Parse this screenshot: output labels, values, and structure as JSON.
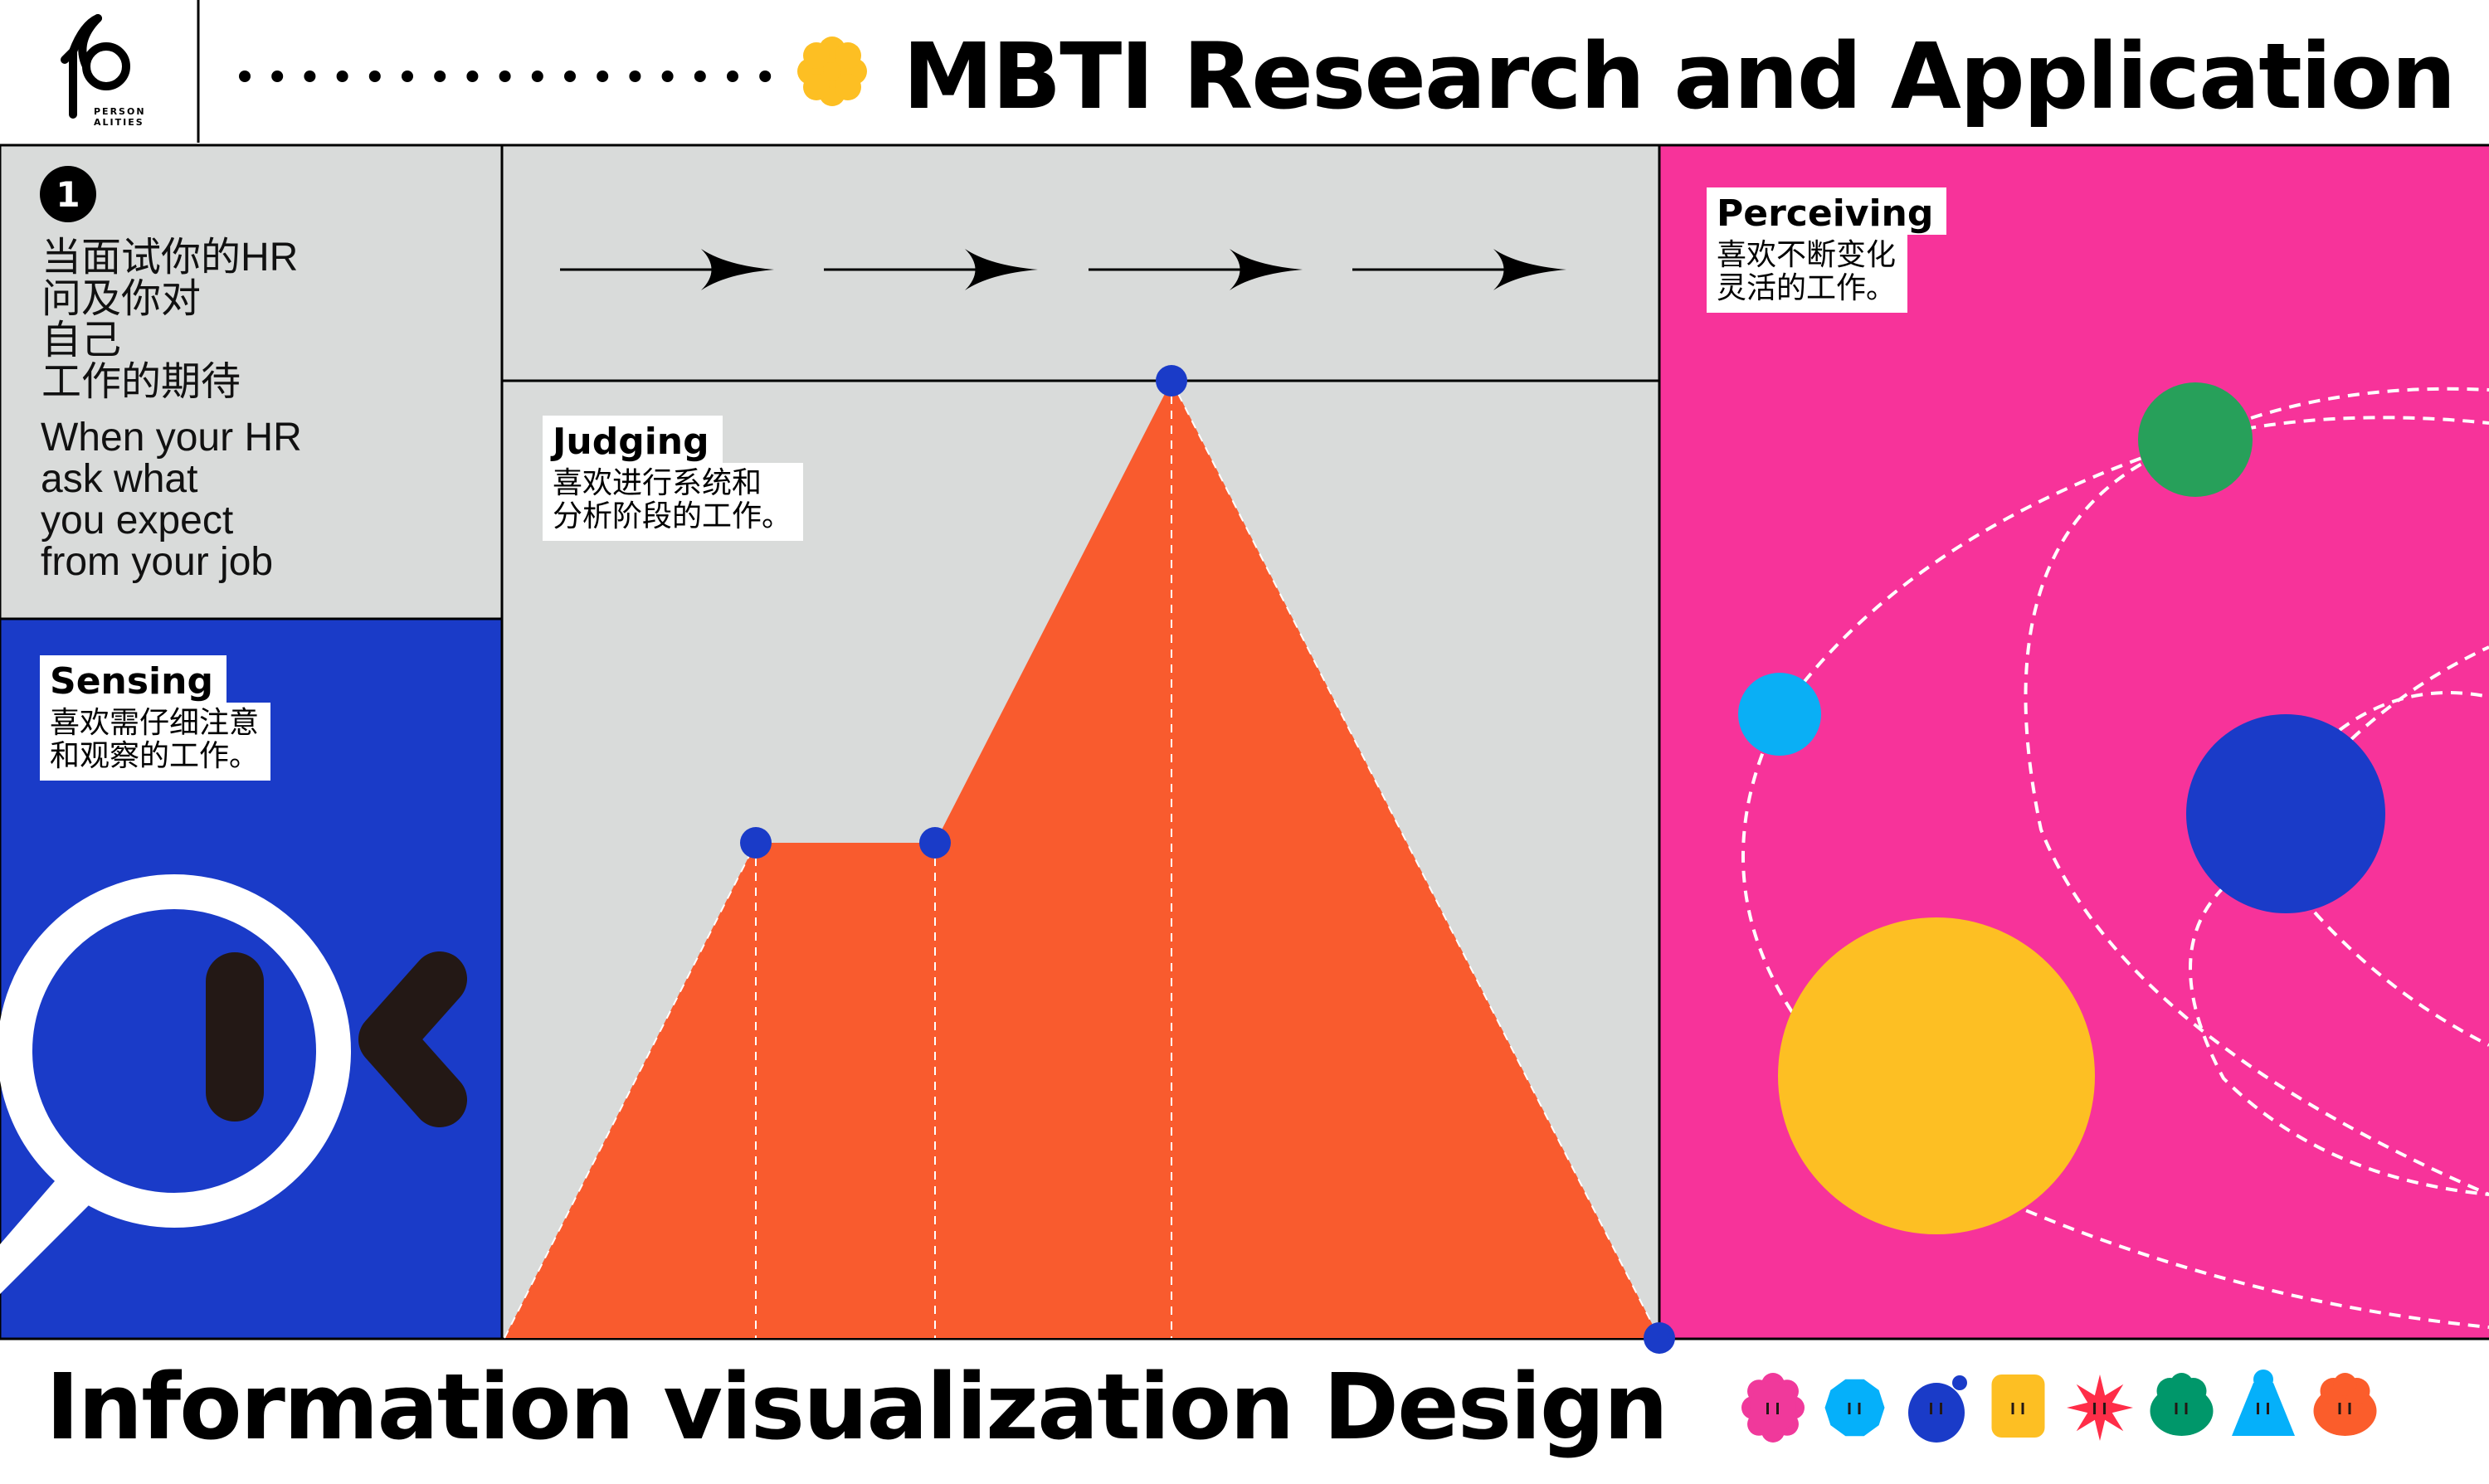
{
  "header": {
    "logo": {
      "number": "16",
      "text_line1": "PERSON",
      "text_line2": "ALITIES"
    },
    "title": "MBTI Research and Application",
    "dot_count": 17
  },
  "intro": {
    "step_number": "1",
    "chinese": "当面试你的HR\n问及你对\n自己\n工作的期待",
    "english": "When your HR\nask what\nyou expect\nfrom your job"
  },
  "sensing": {
    "title": "Sensing",
    "body": "喜欢需仔细注意\n和观察的工作。"
  },
  "judging": {
    "title": "Judging",
    "body": "喜欢进行系统和\n分析阶段的工作。"
  },
  "perceiving": {
    "title": "Perceiving",
    "body": "喜欢不断变化\n灵活的工作。"
  },
  "footer": {
    "title": "Information visualization Design"
  },
  "colors": {
    "gray": "#d9dbda",
    "blue": "#1a3bc8",
    "pink": "#f7339a",
    "orange": "#f95b2e",
    "yellow": "#fdbf23",
    "green": "#27a05a",
    "cyan": "#0aaff5",
    "dot_blue": "#1a3bc8"
  },
  "characters": [
    {
      "icon": "pink-flower-character-icon",
      "color": "#f0399b"
    },
    {
      "icon": "cyan-octagon-character-icon",
      "color": "#05b0fa"
    },
    {
      "icon": "blue-blob-character-icon",
      "color": "#1a3bc8"
    },
    {
      "icon": "yellow-block-character-icon",
      "color": "#fdbf23"
    },
    {
      "icon": "red-star-character-icon",
      "color": "#ff2d48"
    },
    {
      "icon": "green-cloud-character-icon",
      "color": "#00976a"
    },
    {
      "icon": "cyan-cone-character-icon",
      "color": "#05b0fa"
    },
    {
      "icon": "orange-cloud-character-icon",
      "color": "#fb5d2b"
    }
  ]
}
